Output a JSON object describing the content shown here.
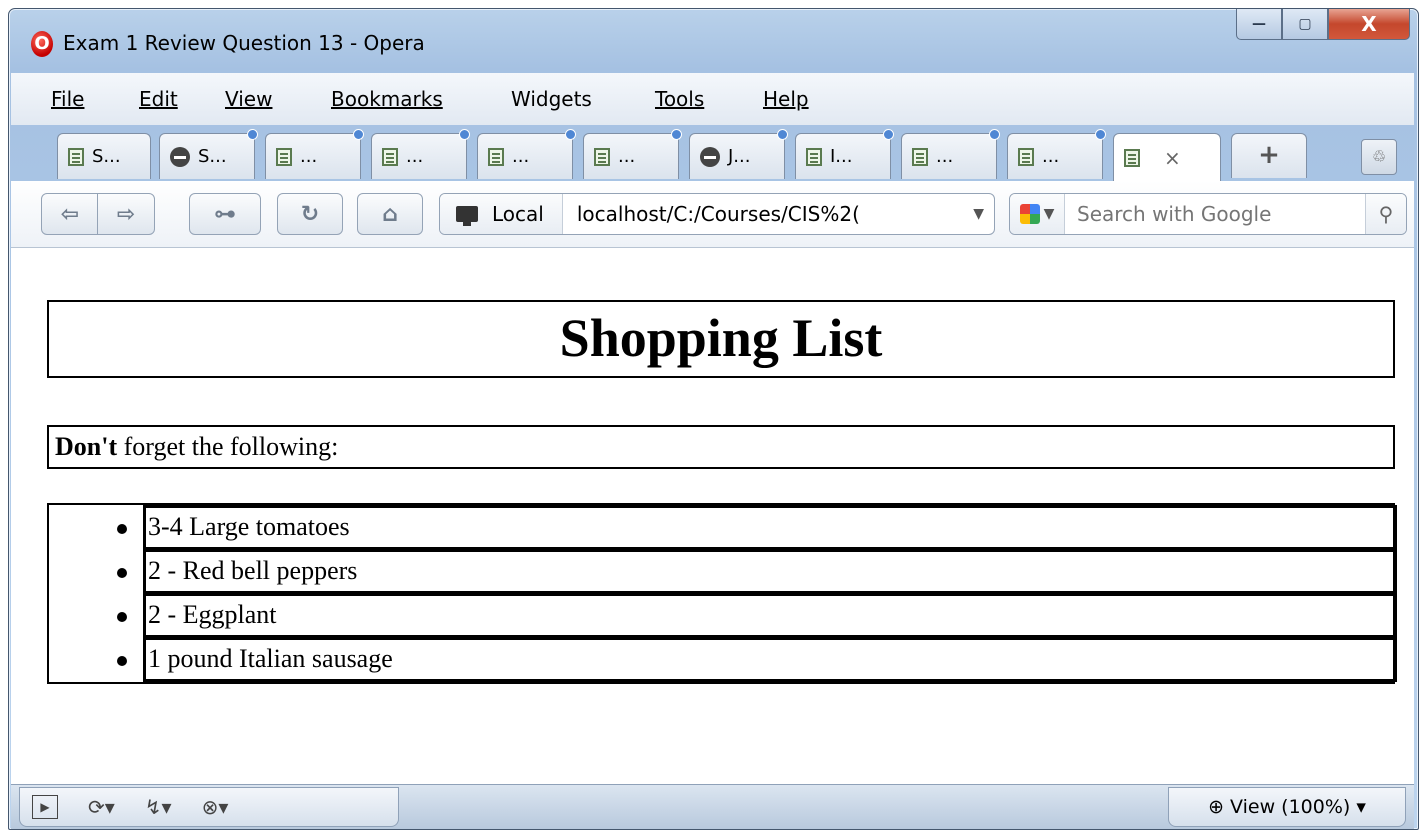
{
  "window": {
    "title": "Exam 1 Review Question 13 - Opera",
    "logo_letter": "O",
    "controls": {
      "minimize": "—",
      "maximize": "▢",
      "close": "X"
    }
  },
  "menu": [
    "File",
    "Edit",
    "View",
    "Bookmarks",
    "Widgets",
    "Tools",
    "Help"
  ],
  "tabs": [
    {
      "label": "S...",
      "icon": "page-icon"
    },
    {
      "label": "S...",
      "icon": "opera-dots-icon"
    },
    {
      "label": "...",
      "icon": "page-icon"
    },
    {
      "label": "...",
      "icon": "page-icon"
    },
    {
      "label": "...",
      "icon": "page-icon"
    },
    {
      "label": "...",
      "icon": "page-icon"
    },
    {
      "label": "J...",
      "icon": "opera-dots-icon"
    },
    {
      "label": "I...",
      "icon": "page-icon"
    },
    {
      "label": "...",
      "icon": "page-icon"
    },
    {
      "label": "...",
      "icon": "page-icon"
    },
    {
      "label": "×",
      "icon": "page-icon",
      "active": true
    }
  ],
  "new_tab_label": "+",
  "nav": {
    "back": "⇦",
    "forward": "⇨",
    "key": "⊶",
    "reload": "↻",
    "home": "⌂",
    "site_badge": "Local",
    "address": "localhost/C:/Courses/CIS%2(",
    "search_placeholder": "Search with Google"
  },
  "page": {
    "heading": "Shopping List",
    "note_bold": "Don't",
    "note_rest": " forget the following:",
    "items": [
      "3-4 Large tomatoes",
      "2 - Red bell peppers",
      "2 - Eggplant",
      "1 pound Italian sausage"
    ]
  },
  "status": {
    "zoom": "View (100%)"
  },
  "colors": {
    "accent": "#4f87d4",
    "close_red": "#c4472c"
  }
}
